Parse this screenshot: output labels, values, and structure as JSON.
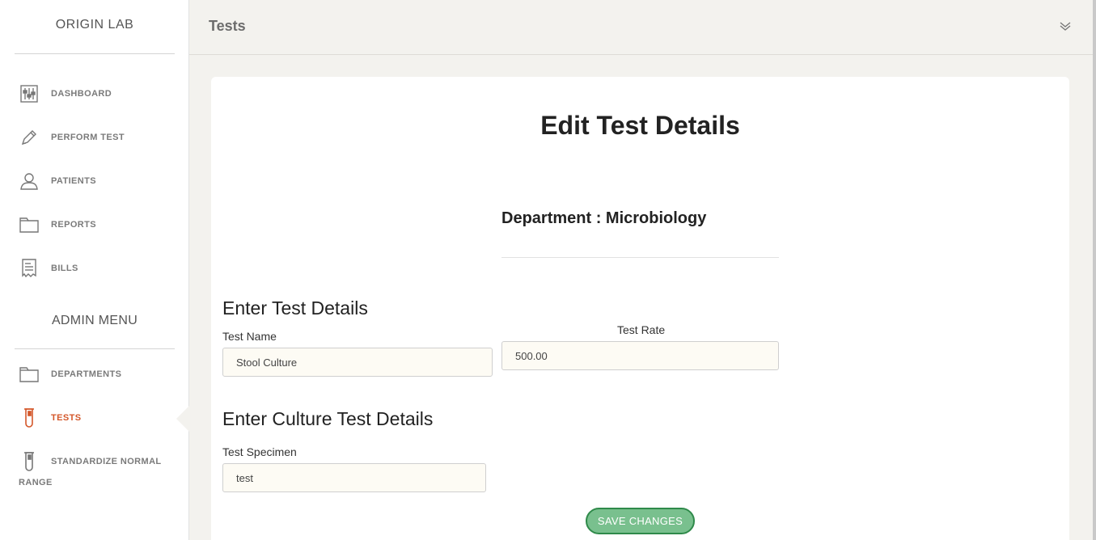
{
  "sidebar": {
    "brand": "ORIGIN LAB",
    "main_items": [
      {
        "label": "DASHBOARD",
        "icon": "sliders-icon"
      },
      {
        "label": "PERFORM TEST",
        "icon": "pen-icon"
      },
      {
        "label": "PATIENTS",
        "icon": "user-icon"
      },
      {
        "label": "REPORTS",
        "icon": "folder-icon"
      },
      {
        "label": "BILLS",
        "icon": "receipt-icon"
      }
    ],
    "admin_title": "ADMIN MENU",
    "admin_items": [
      {
        "label": "DEPARTMENTS",
        "icon": "folder-icon"
      },
      {
        "label": "TESTS",
        "icon": "test-tube-icon",
        "active": true
      },
      {
        "label": "STANDARDIZE NORMAL",
        "label_line2": "RANGE",
        "icon": "test-tube-icon"
      }
    ]
  },
  "header": {
    "title": "Tests",
    "collapse_icon": "double-chevron-down-icon"
  },
  "form": {
    "title": "Edit Test Details",
    "department": "Department : Microbiology",
    "section1": "Enter Test Details",
    "test_name_label": "Test Name",
    "test_name_value": "Stool Culture",
    "test_rate_label": "Test Rate",
    "test_rate_value": "500.00",
    "section2": "Enter Culture Test Details",
    "specimen_label": "Test Specimen",
    "specimen_value": "test",
    "save_label": "SAVE CHANGES"
  },
  "colors": {
    "active": "#d4572a",
    "save_button": "#79c08e",
    "save_border": "#2f8a4a",
    "input_bg": "#fdfbf4"
  }
}
